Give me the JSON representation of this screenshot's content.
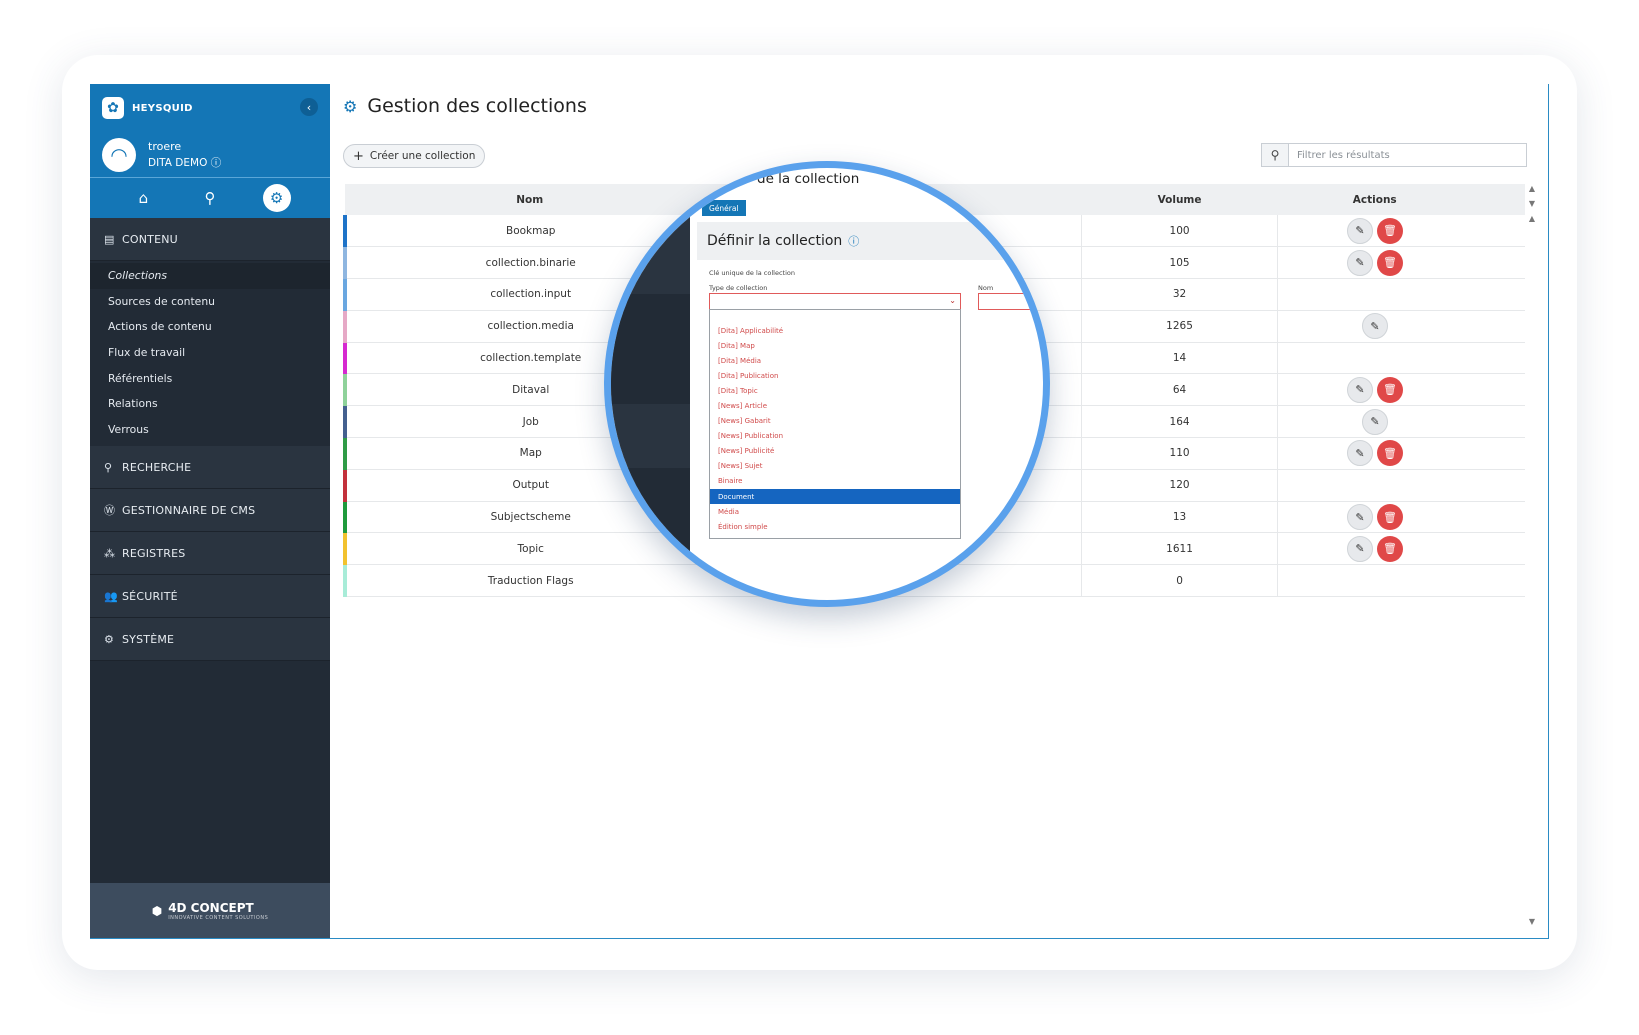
{
  "brand": {
    "name": "HEYSQUID"
  },
  "user": {
    "name": "troere",
    "org": "DITA DEMO"
  },
  "sidebar": {
    "sections": [
      {
        "label": "CONTENU",
        "icon": "document-icon"
      },
      {
        "label": "RECHERCHE",
        "icon": "search-icon"
      },
      {
        "label": "GESTIONNAIRE DE CMS",
        "icon": "wordpress-icon"
      },
      {
        "label": "REGISTRES",
        "icon": "registers-icon"
      },
      {
        "label": "SÉCURITÉ",
        "icon": "users-icon"
      },
      {
        "label": "SYSTÈME",
        "icon": "cogs-icon"
      }
    ],
    "items": [
      {
        "label": "Collections"
      },
      {
        "label": "Sources de contenu"
      },
      {
        "label": "Actions de contenu"
      },
      {
        "label": "Flux de travail"
      },
      {
        "label": "Référentiels"
      },
      {
        "label": "Relations"
      },
      {
        "label": "Verrous"
      }
    ],
    "footer": {
      "logo": "4D CONCEPT",
      "tagline": "INNOVATIVE CONTENT SOLUTIONS"
    }
  },
  "page": {
    "title": "Gestion des collections"
  },
  "toolbar": {
    "create_label": "Créer une collection",
    "search_placeholder": "Filtrer les résultats"
  },
  "table": {
    "columns": {
      "name": "Nom",
      "volume": "Volume",
      "actions": "Actions"
    },
    "rows": [
      {
        "name": "Bookmap",
        "volume": "100",
        "color": "#1e73c8",
        "edit": true,
        "delete": true
      },
      {
        "name": "collection.binarie",
        "volume": "105",
        "color": "#8fb6e0",
        "edit": true,
        "delete": true
      },
      {
        "name": "collection.input",
        "volume": "32",
        "color": "#6aa7e0",
        "edit": false,
        "delete": false
      },
      {
        "name": "collection.media",
        "volume": "1265",
        "color": "#e6a9c6",
        "edit": true,
        "delete": false
      },
      {
        "name": "collection.template",
        "volume": "14",
        "color": "#d629d0",
        "edit": false,
        "delete": false
      },
      {
        "name": "Ditaval",
        "volume": "64",
        "color": "#8fd29a",
        "edit": true,
        "delete": true
      },
      {
        "name": "Job",
        "volume": "164",
        "color": "#44608f",
        "edit": true,
        "delete": false
      },
      {
        "name": "Map",
        "volume": "110",
        "color": "#2f9b46",
        "edit": true,
        "delete": true
      },
      {
        "name": "Output",
        "volume": "120",
        "color": "#c3313b",
        "edit": false,
        "delete": false
      },
      {
        "name": "Subjectscheme",
        "volume": "13",
        "color": "#1f9a3c",
        "edit": true,
        "delete": true
      },
      {
        "name": "Topic",
        "volume": "1611",
        "color": "#f2c22e",
        "edit": true,
        "delete": true
      },
      {
        "name": "Traduction Flags",
        "volume": "0",
        "color": "#a8ecd8",
        "edit": false,
        "delete": false
      }
    ]
  },
  "zoom": {
    "title_fragment": "de la collection",
    "tab_label": "Général",
    "panel_title": "Définir la collection",
    "key_label": "Clé unique de la collection",
    "type_label": "Type de collection",
    "name_label": "Nom",
    "options": [
      "[Dita] Applicabilité",
      "[Dita] Map",
      "[Dita] Média",
      "[Dita] Publication",
      "[Dita] Topic",
      "[News] Article",
      "[News] Gabarit",
      "[News] Publication",
      "[News] Publicité",
      "[News] Sujet",
      "Binaire",
      "Document",
      "Média",
      "Édition simple"
    ],
    "selected_option": "Document"
  }
}
